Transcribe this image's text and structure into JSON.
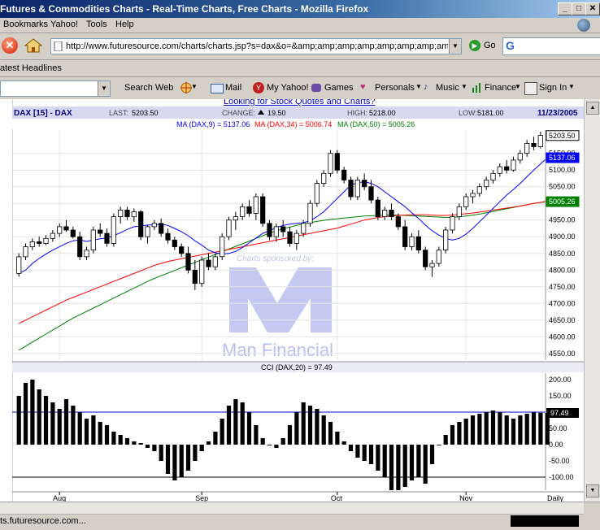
{
  "window": {
    "title": "Futures & Commodities Charts - Real-Time Charts, Free Charts - Mozilla Firefox",
    "min": "_",
    "max": "□",
    "close": "✕"
  },
  "menu": [
    "Bookmarks",
    "Yahoo!",
    "Tools",
    "Help"
  ],
  "nav": {
    "url": "http://www.futuresource.com/charts/charts.jsp?s=dax&o=&amp;amp;amp;amp;amp;amp;amp;amp;amp;a=[",
    "go_label": "Go",
    "search_g": "G"
  },
  "bookmarks_bar": {
    "item": "atest Headlines"
  },
  "yahoo_toolbar": {
    "search_web": "Search Web",
    "items": [
      "Mail",
      "My Yahoo!",
      "Games",
      "Personals",
      "Music",
      "Finance",
      "Sign In"
    ]
  },
  "page": {
    "link_text": "Looking for Stock Quotes and Charts?",
    "sponsor_text": "Charts sponsored by:",
    "sponsor_name": "Man Financial"
  },
  "status": {
    "text": "ts.futuresource.com..."
  },
  "colors": {
    "ma9": "#0000ff",
    "ma34": "#ff0000",
    "ma50": "#008000",
    "up": "#ffffff",
    "down": "#000000",
    "logo": "#b8c0ee"
  },
  "chart_data": {
    "type": "candlestick",
    "symbol": "DAX [15] - DAX",
    "date": "11/23/2005",
    "header": {
      "last_label": "LAST:",
      "last": "5203.50",
      "change_label": "CHANGE:",
      "change": "19.50",
      "high_label": "HIGH:",
      "high": "5218.00",
      "low_label": "LOW:",
      "low": "5181.00"
    },
    "ma_legend": [
      {
        "label": "MA (DAX,9) = 5137.06",
        "color": "#0000ff"
      },
      {
        "label": "MA (DAX,34) = 5006.74",
        "color": "#ff0000"
      },
      {
        "label": "MA (DAX,50) = 5005.26",
        "color": "#008000"
      }
    ],
    "price_ticks": [
      "5150.00",
      "5100.00",
      "5050.00",
      "5000.00",
      "4950.00",
      "4900.00",
      "4850.00",
      "4800.00",
      "4750.00",
      "4700.00",
      "4650.00",
      "4600.00",
      "4550.00"
    ],
    "price_tick_values": [
      5150,
      5100,
      5050,
      5000,
      4950,
      4900,
      4850,
      4800,
      4750,
      4700,
      4650,
      4600,
      4550
    ],
    "price_range": [
      4530,
      5220
    ],
    "price_labels": [
      {
        "text": "5203.50",
        "value": 5203.5,
        "style": "last"
      },
      {
        "text": "5137.06",
        "value": 5137.06,
        "style": "ma9"
      },
      {
        "text": "5005.26",
        "value": 5005.26,
        "style": "ma50"
      }
    ],
    "x_labels": [
      "Aug",
      "Sep",
      "Oct",
      "Nov",
      "Daily"
    ],
    "x_label_index": [
      6,
      27,
      47,
      66
    ],
    "candles": [
      [
        4790,
        4850,
        4780,
        4840
      ],
      [
        4840,
        4880,
        4830,
        4870
      ],
      [
        4870,
        4895,
        4860,
        4885
      ],
      [
        4885,
        4900,
        4870,
        4880
      ],
      [
        4880,
        4905,
        4875,
        4895
      ],
      [
        4895,
        4920,
        4885,
        4910
      ],
      [
        4910,
        4940,
        4900,
        4930
      ],
      [
        4930,
        4950,
        4915,
        4920
      ],
      [
        4920,
        4930,
        4895,
        4900
      ],
      [
        4900,
        4915,
        4830,
        4840
      ],
      [
        4840,
        4870,
        4830,
        4860
      ],
      [
        4860,
        4930,
        4850,
        4920
      ],
      [
        4920,
        4940,
        4900,
        4910
      ],
      [
        4910,
        4925,
        4870,
        4880
      ],
      [
        4880,
        4970,
        4870,
        4960
      ],
      [
        4960,
        4990,
        4940,
        4980
      ],
      [
        4980,
        4990,
        4950,
        4960
      ],
      [
        4960,
        4985,
        4945,
        4975
      ],
      [
        4975,
        4980,
        4890,
        4900
      ],
      [
        4900,
        4935,
        4880,
        4930
      ],
      [
        4930,
        4950,
        4920,
        4940
      ],
      [
        4940,
        4955,
        4900,
        4910
      ],
      [
        4910,
        4925,
        4880,
        4890
      ],
      [
        4890,
        4900,
        4860,
        4870
      ],
      [
        4870,
        4880,
        4840,
        4850
      ],
      [
        4850,
        4870,
        4790,
        4800
      ],
      [
        4800,
        4830,
        4740,
        4760
      ],
      [
        4760,
        4840,
        4750,
        4830
      ],
      [
        4830,
        4850,
        4800,
        4810
      ],
      [
        4810,
        4850,
        4800,
        4840
      ],
      [
        4840,
        4910,
        4830,
        4900
      ],
      [
        4900,
        4960,
        4890,
        4950
      ],
      [
        4950,
        4975,
        4920,
        4960
      ],
      [
        4960,
        5000,
        4950,
        4990
      ],
      [
        4990,
        5010,
        4960,
        4970
      ],
      [
        4970,
        5030,
        4950,
        5020
      ],
      [
        5020,
        5030,
        4930,
        4940
      ],
      [
        4940,
        4950,
        4890,
        4900
      ],
      [
        4900,
        4940,
        4885,
        4930
      ],
      [
        4930,
        4950,
        4900,
        4915
      ],
      [
        4915,
        4930,
        4870,
        4880
      ],
      [
        4880,
        4920,
        4860,
        4910
      ],
      [
        4910,
        4950,
        4900,
        4940
      ],
      [
        4940,
        5010,
        4930,
        5000
      ],
      [
        5000,
        5070,
        4990,
        5060
      ],
      [
        5060,
        5100,
        5050,
        5090
      ],
      [
        5090,
        5160,
        5080,
        5150
      ],
      [
        5150,
        5160,
        5090,
        5100
      ],
      [
        5100,
        5110,
        5060,
        5070
      ],
      [
        5070,
        5080,
        5010,
        5020
      ],
      [
        5020,
        5080,
        5010,
        5070
      ],
      [
        5070,
        5090,
        5040,
        5050
      ],
      [
        5050,
        5070,
        5000,
        5010
      ],
      [
        5010,
        5020,
        4950,
        4960
      ],
      [
        4960,
        4990,
        4950,
        4980
      ],
      [
        4980,
        5000,
        4950,
        4960
      ],
      [
        4960,
        4970,
        4920,
        4930
      ],
      [
        4930,
        4950,
        4860,
        4870
      ],
      [
        4870,
        4910,
        4860,
        4900
      ],
      [
        4900,
        4920,
        4850,
        4860
      ],
      [
        4860,
        4870,
        4800,
        4810
      ],
      [
        4810,
        4830,
        4780,
        4820
      ],
      [
        4820,
        4870,
        4810,
        4860
      ],
      [
        4860,
        4930,
        4850,
        4920
      ],
      [
        4920,
        4970,
        4910,
        4960
      ],
      [
        4960,
        5000,
        4950,
        4990
      ],
      [
        4990,
        5030,
        4980,
        5020
      ],
      [
        5020,
        5040,
        5000,
        5030
      ],
      [
        5030,
        5060,
        5020,
        5050
      ],
      [
        5050,
        5080,
        5040,
        5070
      ],
      [
        5070,
        5100,
        5060,
        5090
      ],
      [
        5090,
        5120,
        5080,
        5110
      ],
      [
        5110,
        5130,
        5090,
        5100
      ],
      [
        5100,
        5140,
        5095,
        5130
      ],
      [
        5130,
        5160,
        5120,
        5150
      ],
      [
        5150,
        5190,
        5140,
        5180
      ],
      [
        5180,
        5200,
        5160,
        5170
      ],
      [
        5170,
        5215,
        5165,
        5204
      ]
    ],
    "ma9": [
      4790,
      4800,
      4820,
      4835,
      4848,
      4860,
      4870,
      4880,
      4888,
      4890,
      4886,
      4890,
      4894,
      4896,
      4903,
      4912,
      4922,
      4930,
      4932,
      4935,
      4936,
      4938,
      4934,
      4925,
      4915,
      4903,
      4888,
      4875,
      4860,
      4852,
      4848,
      4850,
      4856,
      4868,
      4882,
      4896,
      4910,
      4918,
      4928,
      4934,
      4938,
      4940,
      4942,
      4948,
      4960,
      4975,
      4995,
      5015,
      5035,
      5055,
      5062,
      5065,
      5060,
      5050,
      5035,
      5020,
      5005,
      4990,
      4972,
      4955,
      4935,
      4918,
      4905,
      4895,
      4890,
      4895,
      4908,
      4925,
      4945,
      4965,
      4985,
      5005,
      5025,
      5042,
      5060,
      5080,
      5100,
      5118,
      5137
    ],
    "ma34": [
      4640,
      4650,
      4660,
      4670,
      4680,
      4690,
      4700,
      4710,
      4718,
      4726,
      4734,
      4742,
      4750,
      4758,
      4766,
      4774,
      4782,
      4790,
      4798,
      4806,
      4814,
      4820,
      4826,
      4830,
      4834,
      4838,
      4842,
      4846,
      4850,
      4854,
      4858,
      4862,
      4866,
      4870,
      4874,
      4878,
      4882,
      4886,
      4890,
      4894,
      4898,
      4902,
      4906,
      4910,
      4914,
      4918,
      4922,
      4926,
      4932,
      4938,
      4944,
      4950,
      4954,
      4958,
      4960,
      4962,
      4964,
      4965,
      4966,
      4966,
      4966,
      4965,
      4964,
      4964,
      4965,
      4967,
      4969,
      4971,
      4974,
      4977,
      4980,
      4983,
      4986,
      4989,
      4992,
      4996,
      5000,
      5003,
      5007
    ],
    "ma50": [
      4560,
      4572,
      4584,
      4596,
      4608,
      4620,
      4632,
      4644,
      4656,
      4666,
      4676,
      4686,
      4696,
      4706,
      4716,
      4726,
      4736,
      4746,
      4756,
      4766,
      4775,
      4783,
      4791,
      4799,
      4807,
      4815,
      4823,
      4831,
      4839,
      4847,
      4855,
      4863,
      4871,
      4879,
      4887,
      4895,
      4903,
      4911,
      4918,
      4924,
      4929,
      4934,
      4938,
      4942,
      4946,
      4949,
      4952,
      4954,
      4956,
      4958,
      4960,
      4962,
      4963,
      4964,
      4965,
      4965,
      4965,
      4964,
      4963,
      4962,
      4961,
      4960,
      4959,
      4958,
      4958,
      4960,
      4962,
      4965,
      4968,
      4972,
      4976,
      4980,
      4984,
      4988,
      4992,
      4996,
      5000,
      5003,
      5005
    ],
    "cci": {
      "label": "CCI (DAX,20) = 97.49",
      "ticks": [
        "200.00",
        "150.00",
        "100.00",
        "50.00",
        "0.00",
        "-50.00",
        "-100.00"
      ],
      "tick_values": [
        200,
        150,
        100,
        50,
        0,
        -50,
        -100
      ],
      "range": [
        -140,
        215
      ],
      "levels": [
        100,
        -100
      ],
      "current_label": "97.49",
      "values": [
        150,
        190,
        200,
        170,
        150,
        130,
        110,
        140,
        120,
        100,
        80,
        90,
        70,
        60,
        40,
        30,
        20,
        10,
        5,
        -10,
        -20,
        -50,
        -90,
        -110,
        -100,
        -80,
        -50,
        -20,
        10,
        40,
        80,
        120,
        140,
        130,
        100,
        60,
        20,
        0,
        -10,
        20,
        60,
        100,
        130,
        120,
        110,
        90,
        70,
        40,
        10,
        -20,
        -40,
        -50,
        -60,
        -80,
        -100,
        -140,
        -140,
        -130,
        -110,
        -100,
        -120,
        -60,
        0,
        30,
        60,
        70,
        80,
        90,
        95,
        100,
        105,
        100,
        90,
        80,
        90,
        95,
        100,
        98,
        97.49
      ]
    }
  }
}
